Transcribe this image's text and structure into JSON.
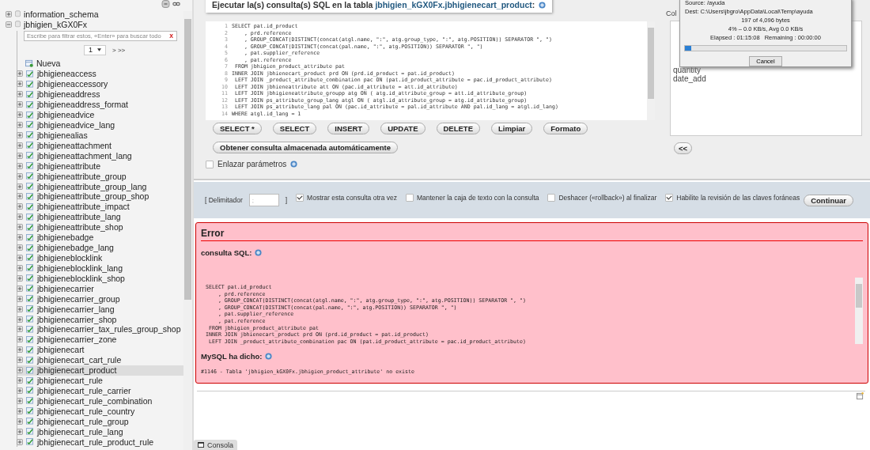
{
  "sidebar": {
    "tree": [
      {
        "label": "information_schema",
        "expanded": false
      },
      {
        "label": "jbhigien_kGX0Fx",
        "expanded": true,
        "filter": {
          "placeholder": "Escribe para filtrar estos, «Enter» para buscar todo",
          "clear": "X"
        },
        "pager": {
          "page": "1",
          "next": "> >>"
        },
        "new_item": "Nueva",
        "children": [
          {
            "label": "jbhigieneaccess",
            "selected": false
          },
          {
            "label": "jbhigieneaccessory",
            "selected": false
          },
          {
            "label": "jbhigieneaddress",
            "selected": false
          },
          {
            "label": "jbhigieneaddress_format",
            "selected": false
          },
          {
            "label": "jbhigieneadvice",
            "selected": false
          },
          {
            "label": "jbhigieneadvice_lang",
            "selected": false
          },
          {
            "label": "jbhigienealias",
            "selected": false
          },
          {
            "label": "jbhigieneattachment",
            "selected": false
          },
          {
            "label": "jbhigieneattachment_lang",
            "selected": false
          },
          {
            "label": "jbhigieneattribute",
            "selected": false
          },
          {
            "label": "jbhigieneattribute_group",
            "selected": false
          },
          {
            "label": "jbhigieneattribute_group_lang",
            "selected": false
          },
          {
            "label": "jbhigieneattribute_group_shop",
            "selected": false
          },
          {
            "label": "jbhigieneattribute_impact",
            "selected": false
          },
          {
            "label": "jbhigieneattribute_lang",
            "selected": false
          },
          {
            "label": "jbhigieneattribute_shop",
            "selected": false
          },
          {
            "label": "jbhigienebadge",
            "selected": false
          },
          {
            "label": "jbhigienebadge_lang",
            "selected": false
          },
          {
            "label": "jbhigieneblocklink",
            "selected": false
          },
          {
            "label": "jbhigieneblocklink_lang",
            "selected": false
          },
          {
            "label": "jbhigieneblocklink_shop",
            "selected": false
          },
          {
            "label": "jbhigienecarrier",
            "selected": false
          },
          {
            "label": "jbhigienecarrier_group",
            "selected": false
          },
          {
            "label": "jbhigienecarrier_lang",
            "selected": false
          },
          {
            "label": "jbhigienecarrier_shop",
            "selected": false
          },
          {
            "label": "jbhigienecarrier_tax_rules_group_shop",
            "selected": false
          },
          {
            "label": "jbhigienecarrier_zone",
            "selected": false
          },
          {
            "label": "jbhigienecart",
            "selected": false
          },
          {
            "label": "jbhigienecart_cart_rule",
            "selected": false
          },
          {
            "label": "jbhigienecart_product",
            "selected": true
          },
          {
            "label": "jbhigienecart_rule",
            "selected": false
          },
          {
            "label": "jbhigienecart_rule_carrier",
            "selected": false
          },
          {
            "label": "jbhigienecart_rule_combination",
            "selected": false
          },
          {
            "label": "jbhigienecart_rule_country",
            "selected": false
          },
          {
            "label": "jbhigienecart_rule_group",
            "selected": false
          },
          {
            "label": "jbhigienecart_rule_lang",
            "selected": false
          },
          {
            "label": "jbhigienecart_rule_product_rule",
            "selected": false
          }
        ]
      }
    ]
  },
  "query_panel": {
    "legend": {
      "text": "Ejecutar la(s) consulta(s) SQL en la tabla",
      "table": "jbhigien_kGX0Fx.jbhigienecart_product",
      "end": ":"
    },
    "editor_lines": [
      {
        "number": "1",
        "code": "SELECT pat.id_product"
      },
      {
        "number": "2",
        "code": "    , prd.reference"
      },
      {
        "number": "3",
        "code": "    , GROUP_CONCAT(DISTINCT(concat(atgl.name, \":\", atg.group_type, \":\", atg.POSITION)) SEPARATOR \", \")"
      },
      {
        "number": "4",
        "code": "    , GROUP_CONCAT(DISTINCT(concat(pal.name, \":\", atg.POSITION)) SEPARATOR \", \")"
      },
      {
        "number": "5",
        "code": "    , pat.supplier_reference"
      },
      {
        "number": "6",
        "code": "    , pat.reference"
      },
      {
        "number": "7",
        "code": " FROM jbhigien_product_attribute pat"
      },
      {
        "number": "8",
        "code": "INNER JOIN jbhienecart_product prd ON (prd.id_product = pat.id_product)"
      },
      {
        "number": "9",
        "code": " LEFT JOIN _product_attribute_combination pac ON (pat.id_product_attribute = pac.id_product_attribute)"
      },
      {
        "number": "10",
        "code": " LEFT JOIN jbhieneattribute att ON (pac.id_attribute = att.id_attribute)"
      },
      {
        "number": "11",
        "code": " LEFT JOIN jbhigieneattribute_groupp atg ON ( atg.id_attribute_group = att.id_attribute_group)"
      },
      {
        "number": "12",
        "code": " LEFT JOIN ps_attribute_group_lang atgl ON ( atgl.id_attribute_group = atg.id_attribute_group)"
      },
      {
        "number": "13",
        "code": " LEFT JOIN ps_attribute_lang pal ON (pac.id_attribute = pal.id_attribute AND pal.id_lang = atgl.id_lang)"
      },
      {
        "number": "14",
        "code": "WHERE atgl.id_lang = 1"
      }
    ],
    "buttons": [
      "SELECT *",
      "SELECT",
      "INSERT",
      "UPDATE",
      "DELETE",
      "Limpiar",
      "Formato"
    ],
    "stored_query_button": "Obtener consulta almacenada automáticamente",
    "bind_parameters": {
      "label": "Enlazar parámetros",
      "checked": false
    },
    "columns": {
      "label": "Col",
      "items": [
        "quantity",
        "date_add"
      ],
      "insert_button": "<<"
    }
  },
  "options": {
    "delimiter_label": "[ Delimitador",
    "delimiter_value": ";",
    "delimiter_end": "]",
    "checkboxes": [
      {
        "label": "Mostrar esta consulta otra vez",
        "checked": true
      },
      {
        "label": "Mantener la caja de texto con la consulta",
        "checked": false
      },
      {
        "label": "Deshacer («rollback») al finalizar",
        "checked": false
      },
      {
        "label": "Habilite la revisión de las claves foráneas",
        "checked": true
      }
    ],
    "submit": "Continuar"
  },
  "error": {
    "title": "Error",
    "sql_label": "consulta SQL:",
    "sql_lines": [
      "SELECT pat.id_product",
      "    , prd.reference",
      "    , GROUP_CONCAT(DISTINCT(concat(atgl.name, \":\", atg.group_type, \":\", atg.POSITION)) SEPARATOR \", \")",
      "    , GROUP_CONCAT(DISTINCT(concat(pal.name, \":\", atg.POSITION)) SEPARATOR \", \")",
      "    , pat.supplier_reference",
      "    , pat.reference",
      " FROM jbhigien_product_attribute pat",
      "INNER JOIN jbhienecart_product prd ON (prd.id_product = pat.id_product)",
      " LEFT JOIN _product_attribute_combination pac ON (pat.id_product_attribute = pac.id_product_attribute)"
    ],
    "mysql_label": "MySQL ha dicho:",
    "message": "#1146 - Tabla 'jbhigien_kGX0Fx.jbhigien_product_attribute' no existe"
  },
  "console_tab": "Consola",
  "download_dialog": {
    "source": "Source: /ayuda",
    "dest": "Dest: C:\\Users\\jbgro\\AppData\\Local\\Temp\\ayuda",
    "bytes": "197 of 4,096 bytes",
    "rate": "4% – 0.0 KB/s, Avg 0.0 KB/s",
    "elapsed": "Elapsed : 01:15:08",
    "remaining": "Remaining : 00:00:00",
    "level": 0.04,
    "cancel": "Cancel"
  }
}
